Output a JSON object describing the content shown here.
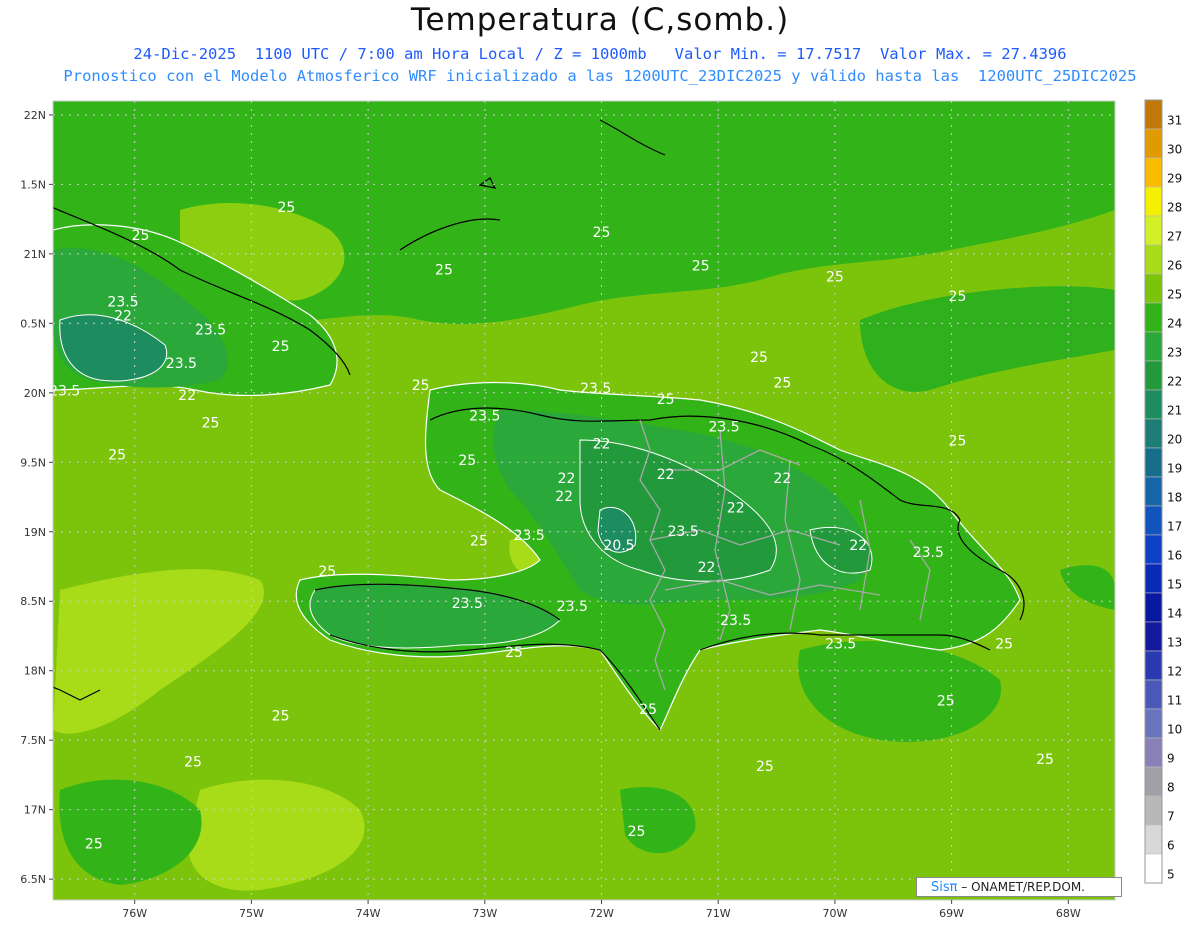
{
  "title": "Temperatura (C,somb.)",
  "subtitle_line1": "24-Dic-2025  1100 UTC / 7:00 am Hora Local / Z = 1000mb   Valor Min. = 17.7517  Valor Max. = 27.4396",
  "subtitle_line2": "Pronostico con el Modelo Atmosferico WRF inicializado a las 1200UTC_23DIC2025 y válido hasta las  1200UTC_25DIC2025",
  "credit": {
    "brand": "Sisπ",
    "text": " – ONAMET/REP.DOM."
  },
  "map": {
    "lon_range": [
      -76.7,
      -67.6
    ],
    "lat_range": [
      16.35,
      22.1
    ],
    "lat_ticks": [
      {
        "value": 22.0,
        "label": "22N"
      },
      {
        "value": 21.5,
        "label": "1.5N"
      },
      {
        "value": 21.0,
        "label": "21N"
      },
      {
        "value": 20.5,
        "label": "0.5N"
      },
      {
        "value": 20.0,
        "label": "20N"
      },
      {
        "value": 19.5,
        "label": "9.5N"
      },
      {
        "value": 19.0,
        "label": "19N"
      },
      {
        "value": 18.5,
        "label": "8.5N"
      },
      {
        "value": 18.0,
        "label": "18N"
      },
      {
        "value": 17.5,
        "label": "7.5N"
      },
      {
        "value": 17.0,
        "label": "17N"
      },
      {
        "value": 16.5,
        "label": "6.5N"
      }
    ],
    "lon_ticks": [
      {
        "value": -76,
        "label": "76W"
      },
      {
        "value": -75,
        "label": "75W"
      },
      {
        "value": -74,
        "label": "74W"
      },
      {
        "value": -73,
        "label": "73W"
      },
      {
        "value": -72,
        "label": "72W"
      },
      {
        "value": -71,
        "label": "71W"
      },
      {
        "value": -70,
        "label": "70W"
      },
      {
        "value": -69,
        "label": "69W"
      },
      {
        "value": -68,
        "label": "68W"
      }
    ],
    "contour_labels": [
      {
        "lon": -74.7,
        "lat": 21.3,
        "text": "25"
      },
      {
        "lon": -75.95,
        "lat": 21.1,
        "text": "25"
      },
      {
        "lon": -72.0,
        "lat": 21.12,
        "text": "25"
      },
      {
        "lon": -73.35,
        "lat": 20.85,
        "text": "25"
      },
      {
        "lon": -71.15,
        "lat": 20.88,
        "text": "25"
      },
      {
        "lon": -70.0,
        "lat": 20.8,
        "text": "25"
      },
      {
        "lon": -68.95,
        "lat": 20.66,
        "text": "25"
      },
      {
        "lon": -76.1,
        "lat": 20.62,
        "text": "23.5"
      },
      {
        "lon": -76.1,
        "lat": 20.52,
        "text": "22"
      },
      {
        "lon": -75.35,
        "lat": 20.42,
        "text": "23.5"
      },
      {
        "lon": -74.75,
        "lat": 20.3,
        "text": "25"
      },
      {
        "lon": -75.6,
        "lat": 20.18,
        "text": "23.5"
      },
      {
        "lon": -76.6,
        "lat": 19.98,
        "text": "23.5"
      },
      {
        "lon": -75.55,
        "lat": 19.95,
        "text": "22"
      },
      {
        "lon": -70.65,
        "lat": 20.22,
        "text": "25"
      },
      {
        "lon": -70.45,
        "lat": 20.04,
        "text": "25"
      },
      {
        "lon": -72.05,
        "lat": 20.0,
        "text": "23.5"
      },
      {
        "lon": -71.45,
        "lat": 19.92,
        "text": "25"
      },
      {
        "lon": -73.55,
        "lat": 20.02,
        "text": "25"
      },
      {
        "lon": -75.35,
        "lat": 19.75,
        "text": "25"
      },
      {
        "lon": -73.0,
        "lat": 19.8,
        "text": "23.5"
      },
      {
        "lon": -70.95,
        "lat": 19.72,
        "text": "23.5"
      },
      {
        "lon": -76.15,
        "lat": 19.52,
        "text": "25"
      },
      {
        "lon": -73.15,
        "lat": 19.48,
        "text": "25"
      },
      {
        "lon": -68.95,
        "lat": 19.62,
        "text": "25"
      },
      {
        "lon": -72.0,
        "lat": 19.6,
        "text": "22"
      },
      {
        "lon": -71.45,
        "lat": 19.38,
        "text": "22"
      },
      {
        "lon": -72.3,
        "lat": 19.35,
        "text": "22"
      },
      {
        "lon": -70.45,
        "lat": 19.35,
        "text": "22"
      },
      {
        "lon": -72.32,
        "lat": 19.22,
        "text": "22"
      },
      {
        "lon": -70.85,
        "lat": 19.14,
        "text": "22"
      },
      {
        "lon": -72.62,
        "lat": 18.94,
        "text": "23.5"
      },
      {
        "lon": -71.3,
        "lat": 18.97,
        "text": "23.5"
      },
      {
        "lon": -71.85,
        "lat": 18.87,
        "text": "20.5"
      },
      {
        "lon": -73.05,
        "lat": 18.9,
        "text": "25"
      },
      {
        "lon": -69.8,
        "lat": 18.87,
        "text": "22"
      },
      {
        "lon": -69.2,
        "lat": 18.82,
        "text": "23.5"
      },
      {
        "lon": -71.1,
        "lat": 18.71,
        "text": "22"
      },
      {
        "lon": -74.35,
        "lat": 18.68,
        "text": "25"
      },
      {
        "lon": -73.15,
        "lat": 18.45,
        "text": "23.5"
      },
      {
        "lon": -72.25,
        "lat": 18.43,
        "text": "23.5"
      },
      {
        "lon": -70.85,
        "lat": 18.33,
        "text": "23.5"
      },
      {
        "lon": -69.95,
        "lat": 18.16,
        "text": "23.5"
      },
      {
        "lon": -68.55,
        "lat": 18.16,
        "text": "25"
      },
      {
        "lon": -72.75,
        "lat": 18.1,
        "text": "25"
      },
      {
        "lon": -71.6,
        "lat": 17.69,
        "text": "25"
      },
      {
        "lon": -74.75,
        "lat": 17.64,
        "text": "25"
      },
      {
        "lon": -69.05,
        "lat": 17.75,
        "text": "25"
      },
      {
        "lon": -75.5,
        "lat": 17.31,
        "text": "25"
      },
      {
        "lon": -70.6,
        "lat": 17.28,
        "text": "25"
      },
      {
        "lon": -68.2,
        "lat": 17.33,
        "text": "25"
      },
      {
        "lon": -71.7,
        "lat": 16.81,
        "text": "25"
      },
      {
        "lon": -76.35,
        "lat": 16.72,
        "text": "25"
      }
    ]
  },
  "colorbar": {
    "levels": [
      "31",
      "30",
      "29",
      "28",
      "27",
      "26",
      "25",
      "24",
      "23",
      "22",
      "21",
      "20",
      "19",
      "18",
      "17",
      "16",
      "15",
      "14",
      "13",
      "12",
      "11",
      "10",
      "9",
      "8",
      "7",
      "6",
      "5"
    ],
    "colors": [
      "#c07808",
      "#e19a00",
      "#fbbc00",
      "#f4f000",
      "#d2ef28",
      "#a8dc18",
      "#7cc40c",
      "#32b419",
      "#2aa83a",
      "#229a3c",
      "#1d8c5e",
      "#1c7c76",
      "#166e8a",
      "#1565a8",
      "#1254bc",
      "#0f40c8",
      "#0a2ab8",
      "#0818a0",
      "#14189a",
      "#2a3ab0",
      "#4a58b8",
      "#6a74be",
      "#8a80b8",
      "#a0a0a8",
      "#b8b8b8",
      "#d8d8d8",
      "#ffffff"
    ]
  }
}
